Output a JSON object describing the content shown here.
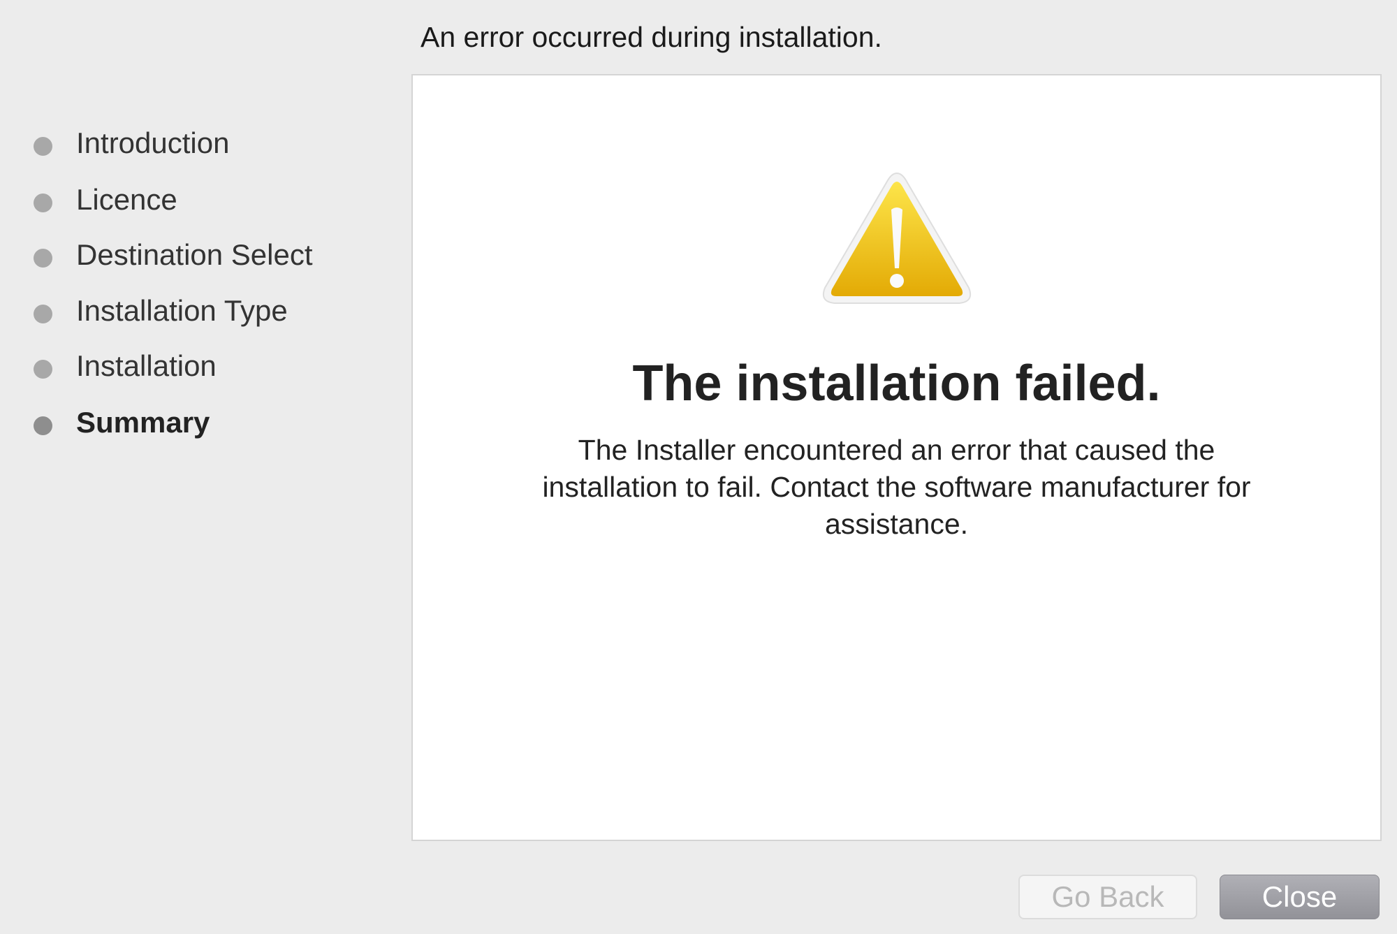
{
  "header": {
    "text": "An error occurred during installation."
  },
  "sidebar": {
    "steps": [
      {
        "label": "Introduction"
      },
      {
        "label": "Licence"
      },
      {
        "label": "Destination Select"
      },
      {
        "label": "Installation Type"
      },
      {
        "label": "Installation"
      },
      {
        "label": "Summary",
        "current": true
      }
    ]
  },
  "main": {
    "icon": "warning-triangle-icon",
    "title": "The installation failed.",
    "message": "The Installer encountered an error that caused the installation to fail. Contact the software manufacturer for assistance."
  },
  "footer": {
    "go_back_label": "Go Back",
    "go_back_enabled": false,
    "close_label": "Close"
  },
  "colors": {
    "warning_yellow": "#f2c40f",
    "background": "#ececec"
  }
}
